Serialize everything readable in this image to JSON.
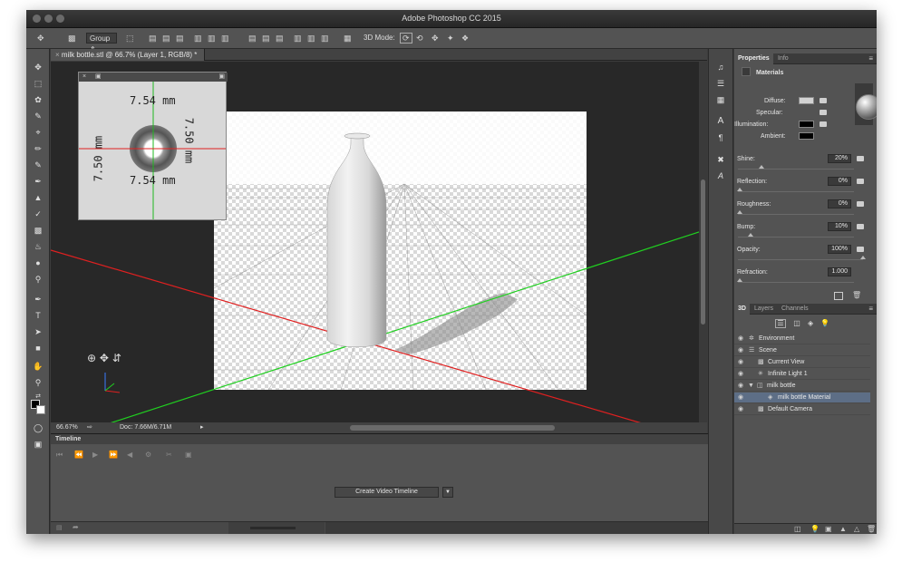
{
  "app": {
    "title": "Adobe Photoshop CC 2015"
  },
  "options_bar": {
    "mode_select": "Group",
    "mode_3d_label": "3D Mode:"
  },
  "document": {
    "tab_label": "milk bottle.stl @ 66.7% (Layer 1, RGB/8) *"
  },
  "status": {
    "zoom": "66.67%",
    "doc_info": "Doc: 7.66M/6.71M"
  },
  "secondary_view": {
    "top_dim": "7.54 mm",
    "bottom_dim": "7.54 mm",
    "left_dim": "7.50 mm",
    "right_dim": "7.50 mm"
  },
  "timeline": {
    "title": "Timeline",
    "create_button": "Create Video Timeline"
  },
  "properties": {
    "tab_properties": "Properties",
    "tab_info": "Info",
    "section": "Materials",
    "diffuse_label": "Diffuse:",
    "specular_label": "Specular:",
    "illumination_label": "Illumination:",
    "ambient_label": "Ambient:",
    "diffuse_color": "#d2d2d2",
    "illumination_color": "#000000",
    "ambient_color": "#000000",
    "fields": [
      {
        "label": "Shine:",
        "value": "20%",
        "level": 0.2
      },
      {
        "label": "Reflection:",
        "value": "0%",
        "level": 0
      },
      {
        "label": "Roughness:",
        "value": "0%",
        "level": 0
      },
      {
        "label": "Bump:",
        "value": "10%",
        "level": 0.1
      },
      {
        "label": "Opacity:",
        "value": "100%",
        "level": 1
      },
      {
        "label": "Refraction:",
        "value": "1.000",
        "level": 0
      }
    ]
  },
  "layers_panel": {
    "tab_3d": "3D",
    "tab_layers": "Layers",
    "tab_channels": "Channels",
    "items": [
      {
        "name": "Environment",
        "icon": "environment-icon"
      },
      {
        "name": "Scene",
        "icon": "scene-icon"
      },
      {
        "name": "Current View",
        "icon": "camera-icon"
      },
      {
        "name": "Infinite Light 1",
        "icon": "light-icon"
      },
      {
        "name": "milk bottle",
        "icon": "mesh-icon"
      },
      {
        "name": "milk bottle Material",
        "icon": "material-icon",
        "selected": true
      },
      {
        "name": "Default Camera",
        "icon": "camera-icon"
      }
    ]
  },
  "colors": {
    "selection": "#5d6e86",
    "axis_red": "#e02020",
    "axis_green": "#20d020"
  }
}
